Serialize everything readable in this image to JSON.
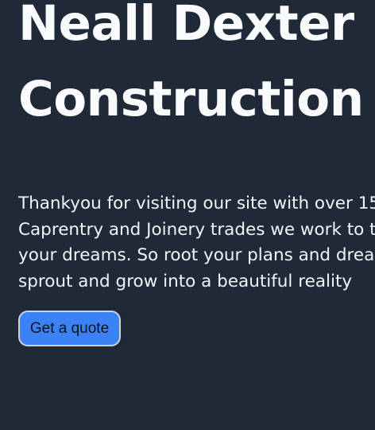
{
  "hero": {
    "title_line1": "Neall Dexter",
    "title_line2": "Construction",
    "intro_line1": "Thankyou for visiting our site with over 15",
    "intro_line2": "Caprentry and Joinery trades we work to th",
    "intro_line3": "your dreams. So root your plans and drean",
    "intro_line4": "sprout and grow into a beautiful reality",
    "cta_label": "Get a quote"
  },
  "colors": {
    "background": "#1f2937",
    "text": "#f9fafb",
    "button": "#3b82f6"
  }
}
